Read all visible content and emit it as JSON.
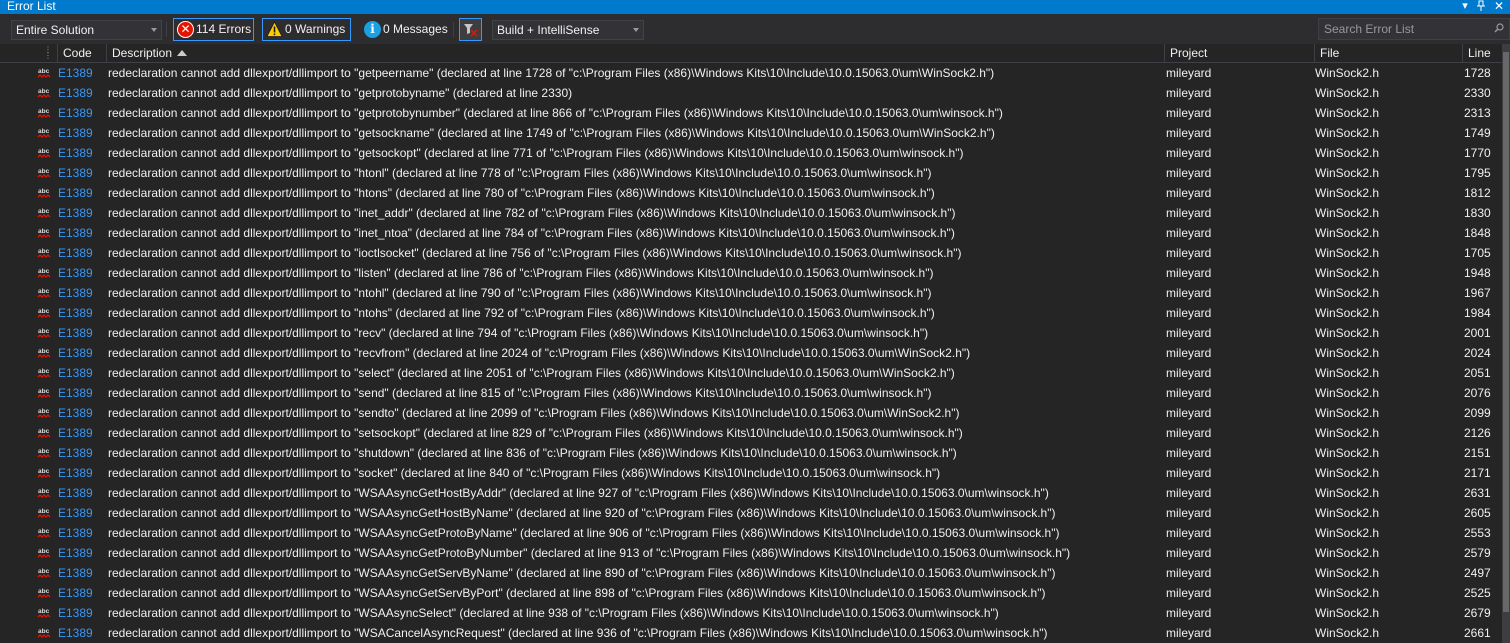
{
  "window": {
    "title": "Error List"
  },
  "toolbar": {
    "scope": "Entire Solution",
    "errors_label": "114 Errors",
    "warnings_label": "0 Warnings",
    "messages_label": "0 Messages",
    "build_filter": "Build + IntelliSense",
    "search_placeholder": "Search Error List"
  },
  "columns": {
    "code": "Code",
    "description": "Description",
    "project": "Project",
    "file": "File",
    "line": "Line"
  },
  "icons": {
    "error": "error-icon",
    "warning": "warning-icon",
    "info": "info-icon",
    "filter": "filter-icon",
    "search": "search-icon",
    "intellisense": "abc-squiggle-icon"
  },
  "colors": {
    "accent": "#007acc",
    "code_link": "#3399ff",
    "error_red": "#e51400",
    "background": "#252526"
  },
  "rows": [
    {
      "code": "E1389",
      "description": "redeclaration cannot add dllexport/dllimport to \"getpeername\" (declared at line 1728 of \"c:\\Program Files (x86)\\Windows Kits\\10\\Include\\10.0.15063.0\\um\\WinSock2.h\")",
      "project": "mileyard",
      "file": "WinSock2.h",
      "line": "1728"
    },
    {
      "code": "E1389",
      "description": "redeclaration cannot add dllexport/dllimport to \"getprotobyname\" (declared at line 2330)",
      "project": "mileyard",
      "file": "WinSock2.h",
      "line": "2330"
    },
    {
      "code": "E1389",
      "description": "redeclaration cannot add dllexport/dllimport to \"getprotobynumber\" (declared at line 866 of \"c:\\Program Files (x86)\\Windows Kits\\10\\Include\\10.0.15063.0\\um\\winsock.h\")",
      "project": "mileyard",
      "file": "WinSock2.h",
      "line": "2313"
    },
    {
      "code": "E1389",
      "description": "redeclaration cannot add dllexport/dllimport to \"getsockname\" (declared at line 1749 of \"c:\\Program Files (x86)\\Windows Kits\\10\\Include\\10.0.15063.0\\um\\WinSock2.h\")",
      "project": "mileyard",
      "file": "WinSock2.h",
      "line": "1749"
    },
    {
      "code": "E1389",
      "description": "redeclaration cannot add dllexport/dllimport to \"getsockopt\" (declared at line 771 of \"c:\\Program Files (x86)\\Windows Kits\\10\\Include\\10.0.15063.0\\um\\winsock.h\")",
      "project": "mileyard",
      "file": "WinSock2.h",
      "line": "1770"
    },
    {
      "code": "E1389",
      "description": "redeclaration cannot add dllexport/dllimport to \"htonl\" (declared at line 778 of \"c:\\Program Files (x86)\\Windows Kits\\10\\Include\\10.0.15063.0\\um\\winsock.h\")",
      "project": "mileyard",
      "file": "WinSock2.h",
      "line": "1795"
    },
    {
      "code": "E1389",
      "description": "redeclaration cannot add dllexport/dllimport to \"htons\" (declared at line 780 of \"c:\\Program Files (x86)\\Windows Kits\\10\\Include\\10.0.15063.0\\um\\winsock.h\")",
      "project": "mileyard",
      "file": "WinSock2.h",
      "line": "1812"
    },
    {
      "code": "E1389",
      "description": "redeclaration cannot add dllexport/dllimport to \"inet_addr\" (declared at line 782 of \"c:\\Program Files (x86)\\Windows Kits\\10\\Include\\10.0.15063.0\\um\\winsock.h\")",
      "project": "mileyard",
      "file": "WinSock2.h",
      "line": "1830"
    },
    {
      "code": "E1389",
      "description": "redeclaration cannot add dllexport/dllimport to \"inet_ntoa\" (declared at line 784 of \"c:\\Program Files (x86)\\Windows Kits\\10\\Include\\10.0.15063.0\\um\\winsock.h\")",
      "project": "mileyard",
      "file": "WinSock2.h",
      "line": "1848"
    },
    {
      "code": "E1389",
      "description": "redeclaration cannot add dllexport/dllimport to \"ioctlsocket\" (declared at line 756 of \"c:\\Program Files (x86)\\Windows Kits\\10\\Include\\10.0.15063.0\\um\\winsock.h\")",
      "project": "mileyard",
      "file": "WinSock2.h",
      "line": "1705"
    },
    {
      "code": "E1389",
      "description": "redeclaration cannot add dllexport/dllimport to \"listen\" (declared at line 786 of \"c:\\Program Files (x86)\\Windows Kits\\10\\Include\\10.0.15063.0\\um\\winsock.h\")",
      "project": "mileyard",
      "file": "WinSock2.h",
      "line": "1948"
    },
    {
      "code": "E1389",
      "description": "redeclaration cannot add dllexport/dllimport to \"ntohl\" (declared at line 790 of \"c:\\Program Files (x86)\\Windows Kits\\10\\Include\\10.0.15063.0\\um\\winsock.h\")",
      "project": "mileyard",
      "file": "WinSock2.h",
      "line": "1967"
    },
    {
      "code": "E1389",
      "description": "redeclaration cannot add dllexport/dllimport to \"ntohs\" (declared at line 792 of \"c:\\Program Files (x86)\\Windows Kits\\10\\Include\\10.0.15063.0\\um\\winsock.h\")",
      "project": "mileyard",
      "file": "WinSock2.h",
      "line": "1984"
    },
    {
      "code": "E1389",
      "description": "redeclaration cannot add dllexport/dllimport to \"recv\" (declared at line 794 of \"c:\\Program Files (x86)\\Windows Kits\\10\\Include\\10.0.15063.0\\um\\winsock.h\")",
      "project": "mileyard",
      "file": "WinSock2.h",
      "line": "2001"
    },
    {
      "code": "E1389",
      "description": "redeclaration cannot add dllexport/dllimport to \"recvfrom\" (declared at line 2024 of \"c:\\Program Files (x86)\\Windows Kits\\10\\Include\\10.0.15063.0\\um\\WinSock2.h\")",
      "project": "mileyard",
      "file": "WinSock2.h",
      "line": "2024"
    },
    {
      "code": "E1389",
      "description": "redeclaration cannot add dllexport/dllimport to \"select\" (declared at line 2051 of \"c:\\Program Files (x86)\\Windows Kits\\10\\Include\\10.0.15063.0\\um\\WinSock2.h\")",
      "project": "mileyard",
      "file": "WinSock2.h",
      "line": "2051"
    },
    {
      "code": "E1389",
      "description": "redeclaration cannot add dllexport/dllimport to \"send\" (declared at line 815 of \"c:\\Program Files (x86)\\Windows Kits\\10\\Include\\10.0.15063.0\\um\\winsock.h\")",
      "project": "mileyard",
      "file": "WinSock2.h",
      "line": "2076"
    },
    {
      "code": "E1389",
      "description": "redeclaration cannot add dllexport/dllimport to \"sendto\" (declared at line 2099 of \"c:\\Program Files (x86)\\Windows Kits\\10\\Include\\10.0.15063.0\\um\\WinSock2.h\")",
      "project": "mileyard",
      "file": "WinSock2.h",
      "line": "2099"
    },
    {
      "code": "E1389",
      "description": "redeclaration cannot add dllexport/dllimport to \"setsockopt\" (declared at line 829 of \"c:\\Program Files (x86)\\Windows Kits\\10\\Include\\10.0.15063.0\\um\\winsock.h\")",
      "project": "mileyard",
      "file": "WinSock2.h",
      "line": "2126"
    },
    {
      "code": "E1389",
      "description": "redeclaration cannot add dllexport/dllimport to \"shutdown\" (declared at line 836 of \"c:\\Program Files (x86)\\Windows Kits\\10\\Include\\10.0.15063.0\\um\\winsock.h\")",
      "project": "mileyard",
      "file": "WinSock2.h",
      "line": "2151"
    },
    {
      "code": "E1389",
      "description": "redeclaration cannot add dllexport/dllimport to \"socket\" (declared at line 840 of \"c:\\Program Files (x86)\\Windows Kits\\10\\Include\\10.0.15063.0\\um\\winsock.h\")",
      "project": "mileyard",
      "file": "WinSock2.h",
      "line": "2171"
    },
    {
      "code": "E1389",
      "description": "redeclaration cannot add dllexport/dllimport to \"WSAAsyncGetHostByAddr\" (declared at line 927 of \"c:\\Program Files (x86)\\Windows Kits\\10\\Include\\10.0.15063.0\\um\\winsock.h\")",
      "project": "mileyard",
      "file": "WinSock2.h",
      "line": "2631"
    },
    {
      "code": "E1389",
      "description": "redeclaration cannot add dllexport/dllimport to \"WSAAsyncGetHostByName\" (declared at line 920 of \"c:\\Program Files (x86)\\Windows Kits\\10\\Include\\10.0.15063.0\\um\\winsock.h\")",
      "project": "mileyard",
      "file": "WinSock2.h",
      "line": "2605"
    },
    {
      "code": "E1389",
      "description": "redeclaration cannot add dllexport/dllimport to \"WSAAsyncGetProtoByName\" (declared at line 906 of \"c:\\Program Files (x86)\\Windows Kits\\10\\Include\\10.0.15063.0\\um\\winsock.h\")",
      "project": "mileyard",
      "file": "WinSock2.h",
      "line": "2553"
    },
    {
      "code": "E1389",
      "description": "redeclaration cannot add dllexport/dllimport to \"WSAAsyncGetProtoByNumber\" (declared at line 913 of \"c:\\Program Files (x86)\\Windows Kits\\10\\Include\\10.0.15063.0\\um\\winsock.h\")",
      "project": "mileyard",
      "file": "WinSock2.h",
      "line": "2579"
    },
    {
      "code": "E1389",
      "description": "redeclaration cannot add dllexport/dllimport to \"WSAAsyncGetServByName\" (declared at line 890 of \"c:\\Program Files (x86)\\Windows Kits\\10\\Include\\10.0.15063.0\\um\\winsock.h\")",
      "project": "mileyard",
      "file": "WinSock2.h",
      "line": "2497"
    },
    {
      "code": "E1389",
      "description": "redeclaration cannot add dllexport/dllimport to \"WSAAsyncGetServByPort\" (declared at line 898 of \"c:\\Program Files (x86)\\Windows Kits\\10\\Include\\10.0.15063.0\\um\\winsock.h\")",
      "project": "mileyard",
      "file": "WinSock2.h",
      "line": "2525"
    },
    {
      "code": "E1389",
      "description": "redeclaration cannot add dllexport/dllimport to \"WSAAsyncSelect\" (declared at line 938 of \"c:\\Program Files (x86)\\Windows Kits\\10\\Include\\10.0.15063.0\\um\\winsock.h\")",
      "project": "mileyard",
      "file": "WinSock2.h",
      "line": "2679"
    },
    {
      "code": "E1389",
      "description": "redeclaration cannot add dllexport/dllimport to \"WSACancelAsyncRequest\" (declared at line 936 of \"c:\\Program Files (x86)\\Windows Kits\\10\\Include\\10.0.15063.0\\um\\winsock.h\")",
      "project": "mileyard",
      "file": "WinSock2.h",
      "line": "2661"
    }
  ]
}
